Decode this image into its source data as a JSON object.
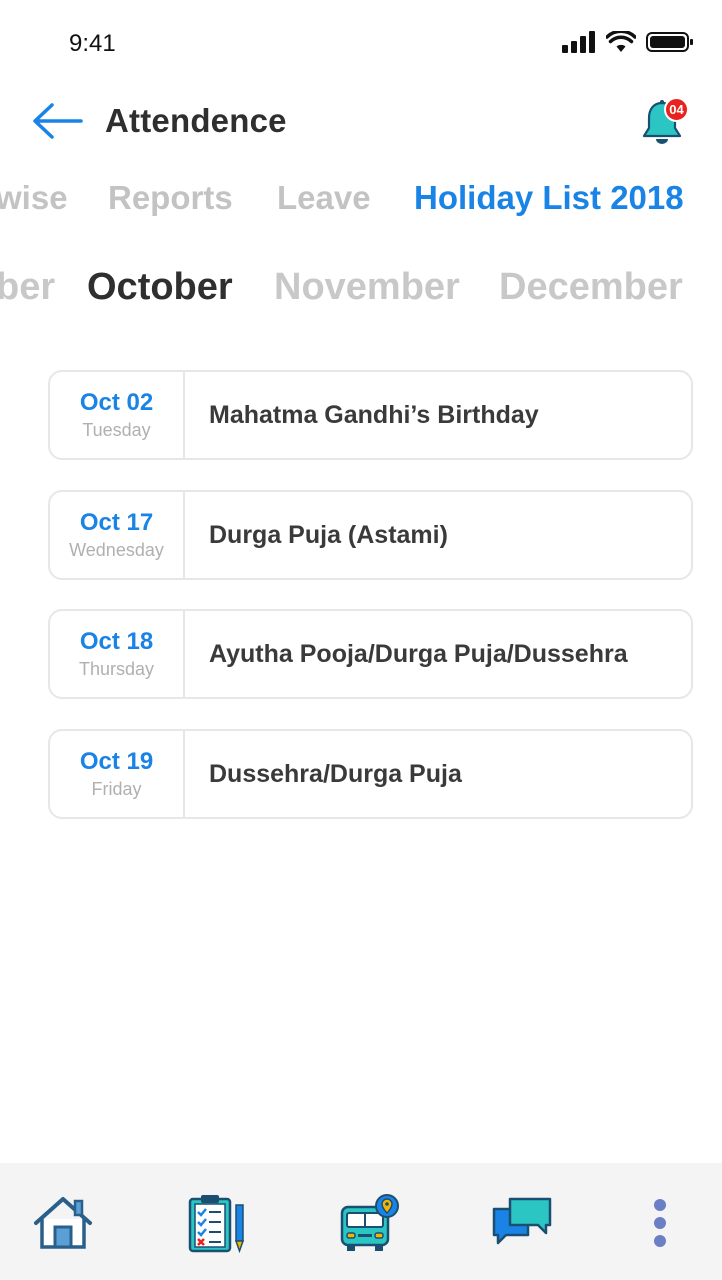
{
  "status_bar": {
    "time": "9:41"
  },
  "header": {
    "title": "Attendence",
    "notification_count": "04",
    "back_icon": "arrow-left-icon",
    "bell_icon": "bell-icon"
  },
  "tabs": [
    {
      "label": "wise",
      "active": false
    },
    {
      "label": "Reports",
      "active": false
    },
    {
      "label": "Leave",
      "active": false
    },
    {
      "label": "Holiday List 2018",
      "active": true
    }
  ],
  "months": [
    {
      "label": "ber",
      "active": false
    },
    {
      "label": "October",
      "active": true
    },
    {
      "label": "November",
      "active": false
    },
    {
      "label": "December",
      "active": false
    }
  ],
  "holidays": [
    {
      "date": "Oct 02",
      "weekday": "Tuesday",
      "name": "Mahatma Gandhi’s Birthday"
    },
    {
      "date": "Oct 17",
      "weekday": "Wednesday",
      "name": "Durga Puja (Astami)"
    },
    {
      "date": "Oct 18",
      "weekday": "Thursday",
      "name": "Ayutha Pooja/Durga Puja/Dussehra"
    },
    {
      "date": "Oct 19",
      "weekday": "Friday",
      "name": "Dussehra/Durga Puja"
    }
  ],
  "bottom_nav": [
    {
      "icon": "home-icon"
    },
    {
      "icon": "clipboard-checklist-icon"
    },
    {
      "icon": "bus-location-icon"
    },
    {
      "icon": "chat-bubbles-icon"
    },
    {
      "icon": "more-vertical-icon"
    }
  ],
  "colors": {
    "accent": "#1a83e6",
    "inactive_tab": "#c3c3c3",
    "badge": "#e8221f",
    "bell": "#2bc6c3"
  }
}
